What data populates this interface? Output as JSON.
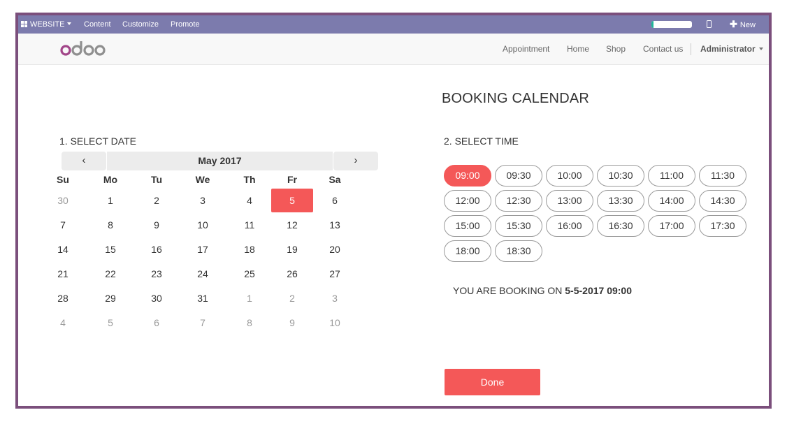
{
  "adminbar": {
    "website_label": "WEBSITE",
    "menu": [
      "Content",
      "Customize",
      "Promote"
    ],
    "progress": 0.05,
    "new_label": "New"
  },
  "header": {
    "logo_text": "odoo",
    "nav": [
      "Appointment",
      "Home",
      "Shop",
      "Contact us"
    ],
    "user": "Administrator"
  },
  "page": {
    "title": "BOOKING CALENDAR",
    "select_date_label": "1. SELECT DATE",
    "select_time_label": "2. SELECT TIME"
  },
  "calendar": {
    "month_label": "May 2017",
    "prev_symbol": "‹",
    "next_symbol": "›",
    "weekdays": [
      "Su",
      "Mo",
      "Tu",
      "We",
      "Th",
      "Fr",
      "Sa"
    ],
    "weeks": [
      [
        "30",
        "1",
        "2",
        "3",
        "4",
        "5",
        "6"
      ],
      [
        "7",
        "8",
        "9",
        "10",
        "11",
        "12",
        "13"
      ],
      [
        "14",
        "15",
        "16",
        "17",
        "18",
        "19",
        "20"
      ],
      [
        "21",
        "22",
        "23",
        "24",
        "25",
        "26",
        "27"
      ],
      [
        "28",
        "29",
        "30",
        "31",
        "1",
        "2",
        "3"
      ],
      [
        "4",
        "5",
        "6",
        "7",
        "8",
        "9",
        "10"
      ]
    ],
    "selected_day": "5"
  },
  "times": {
    "slots": [
      "09:00",
      "09:30",
      "10:00",
      "10:30",
      "11:00",
      "11:30",
      "12:00",
      "12:30",
      "13:00",
      "13:30",
      "14:00",
      "14:30",
      "15:00",
      "15:30",
      "16:00",
      "16:30",
      "17:00",
      "17:30",
      "18:00",
      "18:30"
    ],
    "selected": "09:00"
  },
  "booking": {
    "prefix": "YOU ARE BOOKING ON",
    "value": "5-5-2017 09:00"
  },
  "done_label": "Done",
  "colors": {
    "accent": "#f45858",
    "adminbar": "#7c7bad",
    "frame": "#7b4f7c"
  }
}
